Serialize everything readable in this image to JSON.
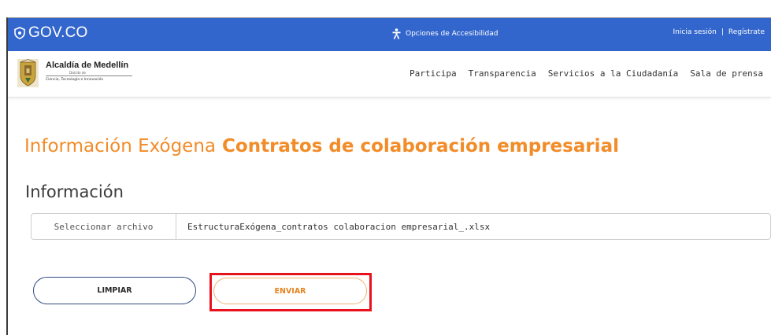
{
  "gov_bar": {
    "logo_text": "GOV.CO",
    "accessibility_label": "Opciones de Accesibilidad",
    "login_label": "Inicia sesión",
    "separator": "|",
    "register_label": "Regístrate"
  },
  "brand": {
    "title": "Alcaldía de Medellín",
    "small": "Distrito de",
    "subtitle": "Ciencia, Tecnología e Innovación"
  },
  "nav": {
    "items": [
      {
        "label": "Participa"
      },
      {
        "label": "Transparencia"
      },
      {
        "label": "Servicios a la Ciudadanía"
      },
      {
        "label": "Sala de prensa"
      }
    ]
  },
  "page": {
    "title_light": "Información Exógena",
    "title_bold": "Contratos de colaboración empresarial",
    "section_label": "Información"
  },
  "file": {
    "button_label": "Seleccionar archivo",
    "selected_name": "EstructuraExógena_contratos colaboracion empresarial_.xlsx"
  },
  "actions": {
    "clear_label": "LIMPIAR",
    "send_label": "ENVIAR"
  },
  "colors": {
    "gov_blue": "#3366cc",
    "accent_orange": "#f28c28",
    "highlight_red": "#e8121c"
  }
}
